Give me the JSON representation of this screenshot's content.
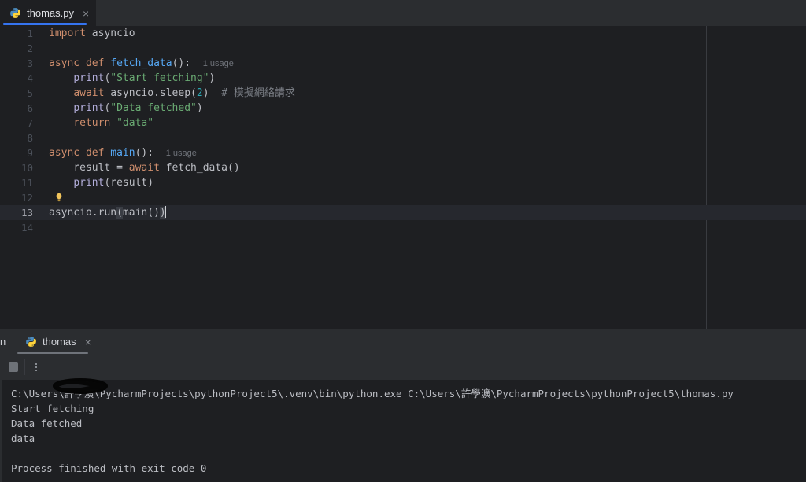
{
  "editor": {
    "tab": {
      "label": "thomas.py",
      "icon": "python-file-icon",
      "close_label": "×"
    },
    "lines": [
      {
        "n": "1",
        "text": "import asyncio"
      },
      {
        "n": "2",
        "text": ""
      },
      {
        "n": "3",
        "text": "async def fetch_data():",
        "usage": "1 usage"
      },
      {
        "n": "4",
        "text": "    print(\"Start fetching\")"
      },
      {
        "n": "5",
        "text": "    await asyncio.sleep(2)  # 模擬網絡請求"
      },
      {
        "n": "6",
        "text": "    print(\"Data fetched\")"
      },
      {
        "n": "7",
        "text": "    return \"data\""
      },
      {
        "n": "8",
        "text": ""
      },
      {
        "n": "9",
        "text": "async def main():",
        "usage": "1 usage"
      },
      {
        "n": "10",
        "text": "    result = await fetch_data()"
      },
      {
        "n": "11",
        "text": "    print(result)"
      },
      {
        "n": "12",
        "text": "",
        "icon": "lightbulb-icon"
      },
      {
        "n": "13",
        "text": "asyncio.run(main())",
        "current": true
      },
      {
        "n": "14",
        "text": ""
      }
    ]
  },
  "run_panel": {
    "partial_label": "n",
    "tab": {
      "label": "thomas",
      "icon": "python-file-icon",
      "close_label": "×"
    },
    "toolbar": {
      "stop_label": "stop-icon",
      "more_label": "more-options-icon"
    },
    "console_lines": [
      "C:\\Users\\許學瀇\\PycharmProjects\\pythonProject5\\.venv\\bin\\python.exe C:\\Users\\許學瀇\\PycharmProjects\\pythonProject5\\thomas.py",
      "Start fetching",
      "Data fetched",
      "data",
      "",
      "Process finished with exit code 0"
    ]
  },
  "colors": {
    "editor_bg": "#1e1f22",
    "panel_bg": "#2b2d30",
    "accent_blue": "#3574f0",
    "keyword": "#cf8e6d",
    "function": "#56a8f5",
    "string": "#6aab73",
    "number": "#2aacb8",
    "comment": "#7a7e85",
    "text": "#bcbec4"
  }
}
